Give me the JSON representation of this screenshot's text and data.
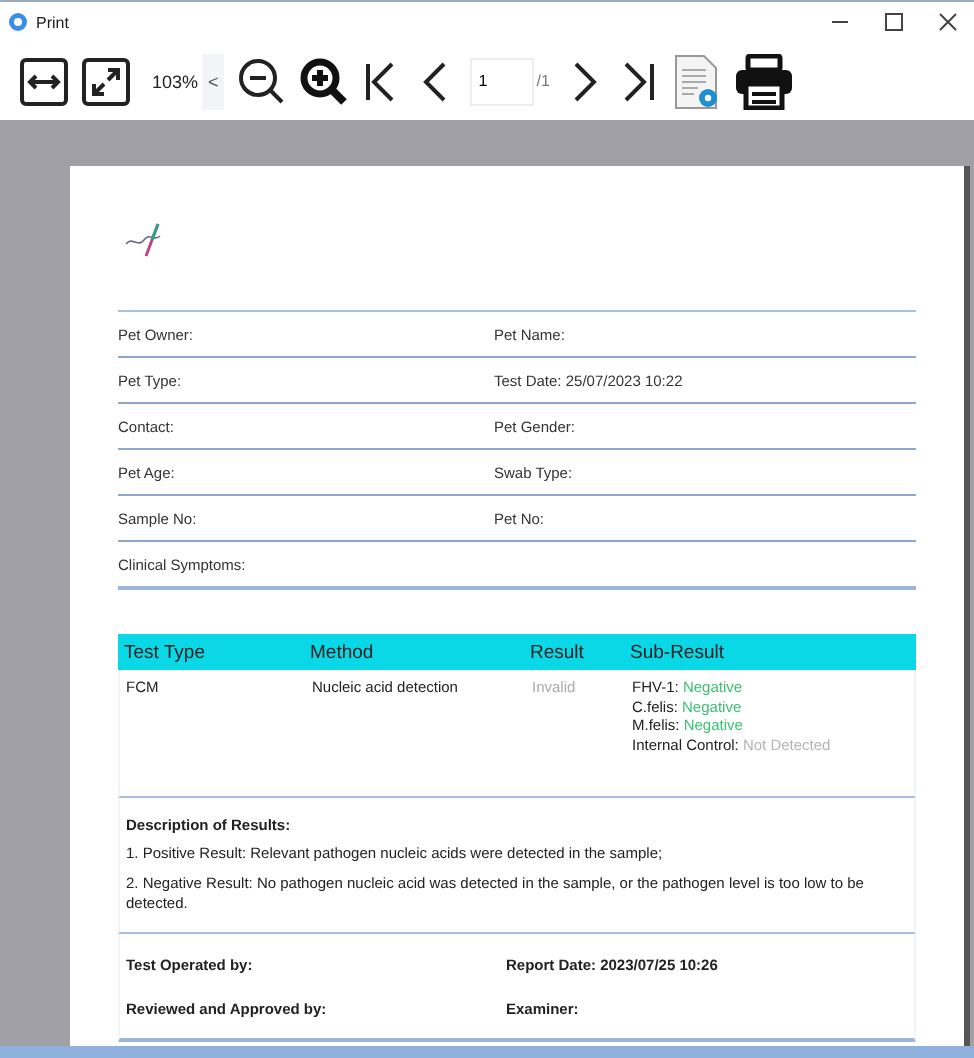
{
  "window": {
    "title": "Print"
  },
  "toolbar": {
    "zoom": "103%",
    "zoom_menu": "<",
    "page": "1",
    "page_count": "/1"
  },
  "info_rows": [
    {
      "left": "Pet Owner:",
      "right": "Pet Name:"
    },
    {
      "left": "Pet Type:",
      "right": "Test Date: 25/07/2023 10:22"
    },
    {
      "left": "Contact:",
      "right": "Pet Gender:"
    },
    {
      "left": "Pet Age:",
      "right": "Swab Type:"
    },
    {
      "left": "Sample No:",
      "right": "Pet No:"
    },
    {
      "left": "Clinical Symptoms:"
    }
  ],
  "results_table": {
    "columns": [
      "Test Type",
      "Method",
      "Result",
      "Sub-Result"
    ],
    "rows": [
      {
        "test_type": "FCM",
        "method": "Nucleic acid detection",
        "result": "Invalid",
        "sub_results": [
          {
            "label": "FHV-1:",
            "value": "Negative",
            "color": "#3cc070"
          },
          {
            "label": "C.felis:",
            "value": "Negative",
            "color": "#3cc070"
          },
          {
            "label": "M.felis:",
            "value": "Negative",
            "color": "#3cc070"
          },
          {
            "label": "Internal Control:",
            "value": "Not Detected",
            "color": "#b4b4b4"
          }
        ]
      }
    ]
  },
  "description": {
    "title": "Description of Results:",
    "lines": [
      "1. Positive Result: Relevant pathogen nucleic acids were detected in the sample;",
      "2. Negative Result: No pathogen nucleic acid was detected in the sample, or the pathogen level is too low to be detected."
    ]
  },
  "signatures": [
    {
      "left": "Test Operated by:",
      "right": "Report Date: 2023/07/25 10:26"
    },
    {
      "left": "Reviewed and Approved by:",
      "right": "Examiner:"
    }
  ]
}
